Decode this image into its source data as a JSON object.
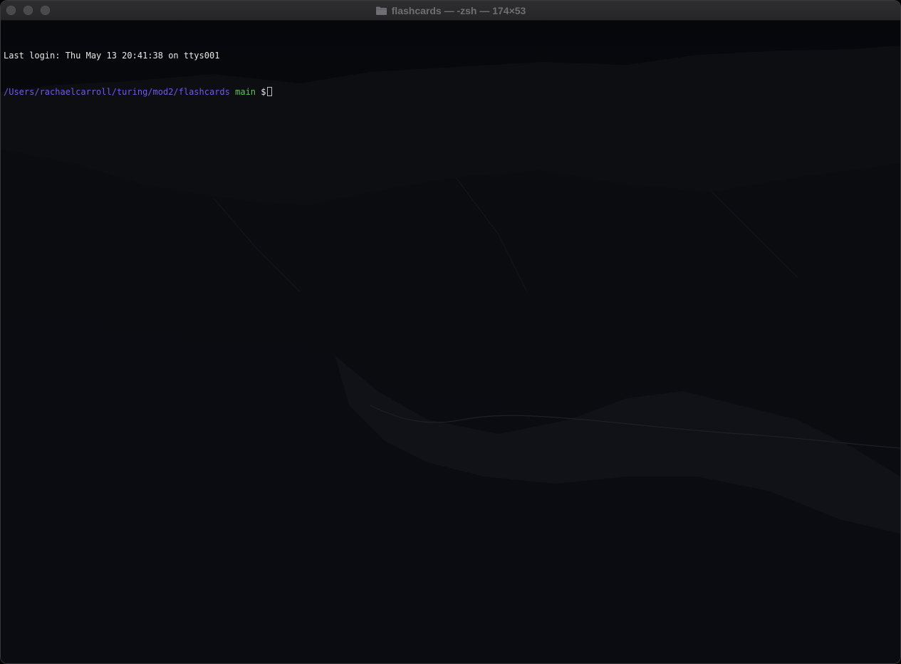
{
  "window": {
    "title": "flashcards — -zsh — 174×53"
  },
  "terminal": {
    "last_login": "Last login: Thu May 13 20:41:38 on ttys001",
    "prompt": {
      "path": "/Users/rachaelcarroll/turing/mod2/flashcards",
      "branch": "main",
      "symbol": "$"
    }
  },
  "colors": {
    "path": "#6d5ce8",
    "branch": "#5fc35f",
    "text": "#e8e8e8",
    "background": "#0a0b10"
  },
  "icons": {
    "title_icon": "folder-icon"
  }
}
